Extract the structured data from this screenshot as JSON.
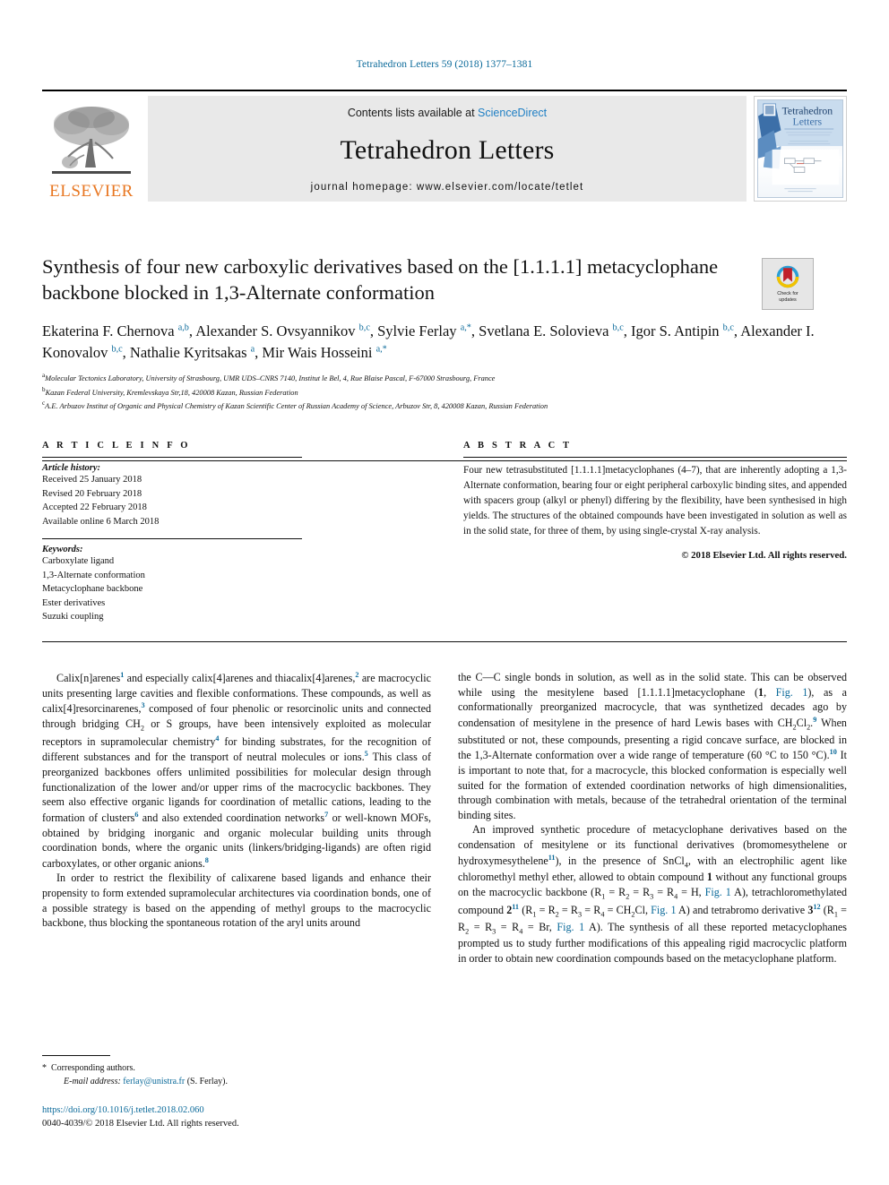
{
  "running_head": "Tetrahedron Letters 59 (2018) 1377–1381",
  "masthead": {
    "contents_prefix": "Contents lists available at ",
    "sciencedirect": "ScienceDirect",
    "journal_name": "Tetrahedron Letters",
    "homepage": "journal homepage: www.elsevier.com/locate/tetlet",
    "publisher_wordmark": "ELSEVIER",
    "cover_title_line1": "Tetrahedron",
    "cover_title_line2": "Letters"
  },
  "article": {
    "title": "Synthesis of four new carboxylic derivatives based on the [1.1.1.1] metacyclophane backbone blocked in 1,3-Alternate conformation",
    "crossmark_label_line1": "Check for",
    "crossmark_label_line2": "updates",
    "authors_html": "Ekaterina F. Chernova <sup>a,b</sup>, Alexander S. Ovsyannikov <sup>b,c</sup>, Sylvie Ferlay <sup>a,*</sup>, Svetlana E. Solovieva <sup>b,c</sup>, Igor S. Antipin <sup>b,c</sup>, Alexander I. Konovalov <sup>b,c</sup>, Nathalie Kyritsakas <sup>a</sup>, Mir Wais Hosseini <sup>a,*</sup>",
    "affiliations": [
      {
        "marker": "a",
        "text": "Molecular Tectonics Laboratory, University of Strasbourg, UMR UDS–CNRS 7140, Institut le Bel, 4, Rue Blaise Pascal, F-67000 Strasbourg, France"
      },
      {
        "marker": "b",
        "text": "Kazan Federal University, Kremlevskaya Str,18, 420008 Kazan, Russian Federation"
      },
      {
        "marker": "c",
        "text": "A.E. Arbuzov Institut of Organic and Physical Chemistry of Kazan Scientific Center of Russian Academy of Science, Arbuzov Str, 8, 420008 Kazan, Russian Federation"
      }
    ]
  },
  "article_info": {
    "heading": "A R T I C L E    I N F O",
    "history_label": "Article history:",
    "history": [
      "Received 25 January 2018",
      "Revised 20 February 2018",
      "Accepted 22 February 2018",
      "Available online 6 March 2018"
    ],
    "keywords_label": "Keywords:",
    "keywords": [
      "Carboxylate ligand",
      "1,3-Alternate conformation",
      "Metacyclophane backbone",
      "Ester derivatives",
      "Suzuki coupling"
    ]
  },
  "abstract": {
    "heading": "A B S T R A C T",
    "text": "Four new tetrasubstituted [1.1.1.1]metacyclophanes (4–7), that are inherently adopting a 1,3-Alternate conformation, bearing four or eight peripheral carboxylic binding sites, and appended with spacers group (alkyl or phenyl) differing by the flexibility, have been synthesised in high yields. The structures of the obtained compounds have been investigated in solution as well as in the solid state, for three of them, by using single-crystal X-ray analysis.",
    "copyright": "© 2018 Elsevier Ltd. All rights reserved."
  },
  "body": {
    "left_col_html": "<p>Calix[n]arenes<sup>1</sup> and especially calix[4]arenes and thiacalix[4]arenes,<sup>2</sup> are macrocyclic units presenting large cavities and flexible conformations. These compounds, as well as calix[4]resorcinarenes,<sup>3</sup> composed of four phenolic or resorcinolic units and connected through bridging CH<sub>2</sub> or S groups, have been intensively exploited as molecular receptors in supramolecular chemistry<sup>4</sup> for binding substrates, for the recognition of different substances and for the transport of neutral molecules or ions.<sup>5</sup> This class of preorganized backbones offers unlimited possibilities for molecular design through functionalization of the lower and/or upper rims of the macrocyclic backbones. They seem also effective organic ligands for coordination of metallic cations, leading to the formation of clusters<sup>6</sup> and also extended coordination networks<sup>7</sup> or well-known MOFs, obtained by bridging inorganic and organic molecular building units through coordination bonds, where the organic units (linkers/bridging-ligands) are often rigid carboxylates, or other organic anions.<sup>8</sup></p><p>In order to restrict the flexibility of calixarene based ligands and enhance their propensity to form extended supramolecular architectures via coordination bonds, one of a possible strategy is based on the appending of methyl groups to the macrocyclic backbone, thus blocking the spontaneous rotation of the aryl units around</p>",
    "right_col_html": "<p style=\"text-indent:0\">the C—C single bonds in solution, as well as in the solid state. This can be observed while using the mesitylene based [1.1.1.1]metacyclophane (<b>1</b>, <span class=\"link\">Fig. 1</span>), as a conformationally preorganized macrocycle, that was synthetized decades ago by condensation of mesitylene in the presence of hard Lewis bases with CH<sub>2</sub>Cl<sub>2</sub>.<sup>9</sup> When substituted or not, these compounds, presenting a rigid concave surface, are blocked in the 1,3-Alternate conformation over a wide range of temperature (60 °C to 150 °C).<sup>10</sup> It is important to note that, for a macrocycle, this blocked conformation is especially well suited for the formation of extended coordination networks of high dimensionalities, through combination with metals, because of the tetrahedral orientation of the terminal binding sites.</p><p>An improved synthetic procedure of metacyclophane derivatives based on the condensation of mesitylene or its functional derivatives (bromomesythelene or hydroxymesythelene<sup>11</sup>), in the presence of SnCl<sub>4</sub>, with an electrophilic agent like chloromethyl methyl ether, allowed to obtain compound <b>1</b> without any functional groups on the macrocyclic backbone (R<sub>1</sub> = R<sub>2</sub> = R<sub>3</sub> = R<sub>4</sub> = H, <span class=\"link\">Fig. 1</span> A), tetrachloromethylated compound <b>2</b><sup>11</sup> (R<sub>1</sub> = R<sub>2</sub> = R<sub>3</sub> = R<sub>4</sub> = CH<sub>2</sub>Cl, <span class=\"link\">Fig. 1</span> A) and tetrabromo derivative <b>3</b><sup>12</sup> (R<sub>1</sub> = R<sub>2</sub> = R<sub>3</sub> = R<sub>4</sub> = Br, <span class=\"link\">Fig. 1</span> A). The synthesis of all these reported metacyclophanes prompted us to study further modifications of this appealing rigid macrocyclic platform in order to obtain new coordination compounds based on the metacyclophane platform.</p>"
  },
  "footnotes": {
    "corresponding": "Corresponding authors.",
    "email_label": "E-mail address:",
    "email": "ferlay@unistra.fr",
    "email_suffix": "(S. Ferlay)."
  },
  "footer": {
    "doi": "https://doi.org/10.1016/j.tetlet.2018.02.060",
    "issn": "0040-4039/© 2018 Elsevier Ltd. All rights reserved."
  },
  "colors": {
    "link_blue": "#0b6a9a",
    "sciencedirect_blue": "#1f7fc4",
    "elsevier_orange": "#E87722"
  }
}
